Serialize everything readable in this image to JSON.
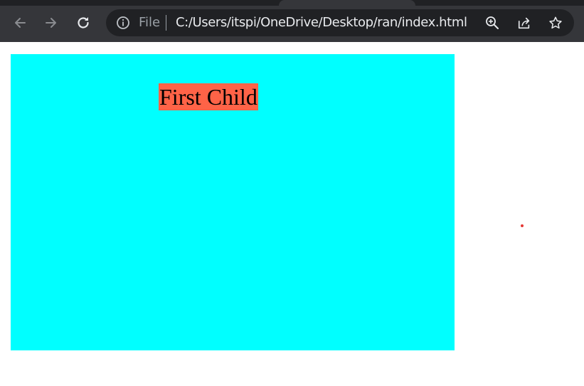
{
  "browser": {
    "address_scheme": "File",
    "address_url": "C:/Users/itspi/OneDrive/Desktop/ran/index.html",
    "icons": {
      "back": "arrow-left-icon",
      "forward": "arrow-right-icon",
      "reload": "reload-icon",
      "info": "info-icon",
      "zoom": "zoom-in-icon",
      "share": "share-icon",
      "bookmark": "star-icon"
    }
  },
  "page": {
    "parent_color": "#00ffff",
    "child_color": "#ff6347",
    "child_text": "First Child",
    "dot_color": "#e53935"
  }
}
